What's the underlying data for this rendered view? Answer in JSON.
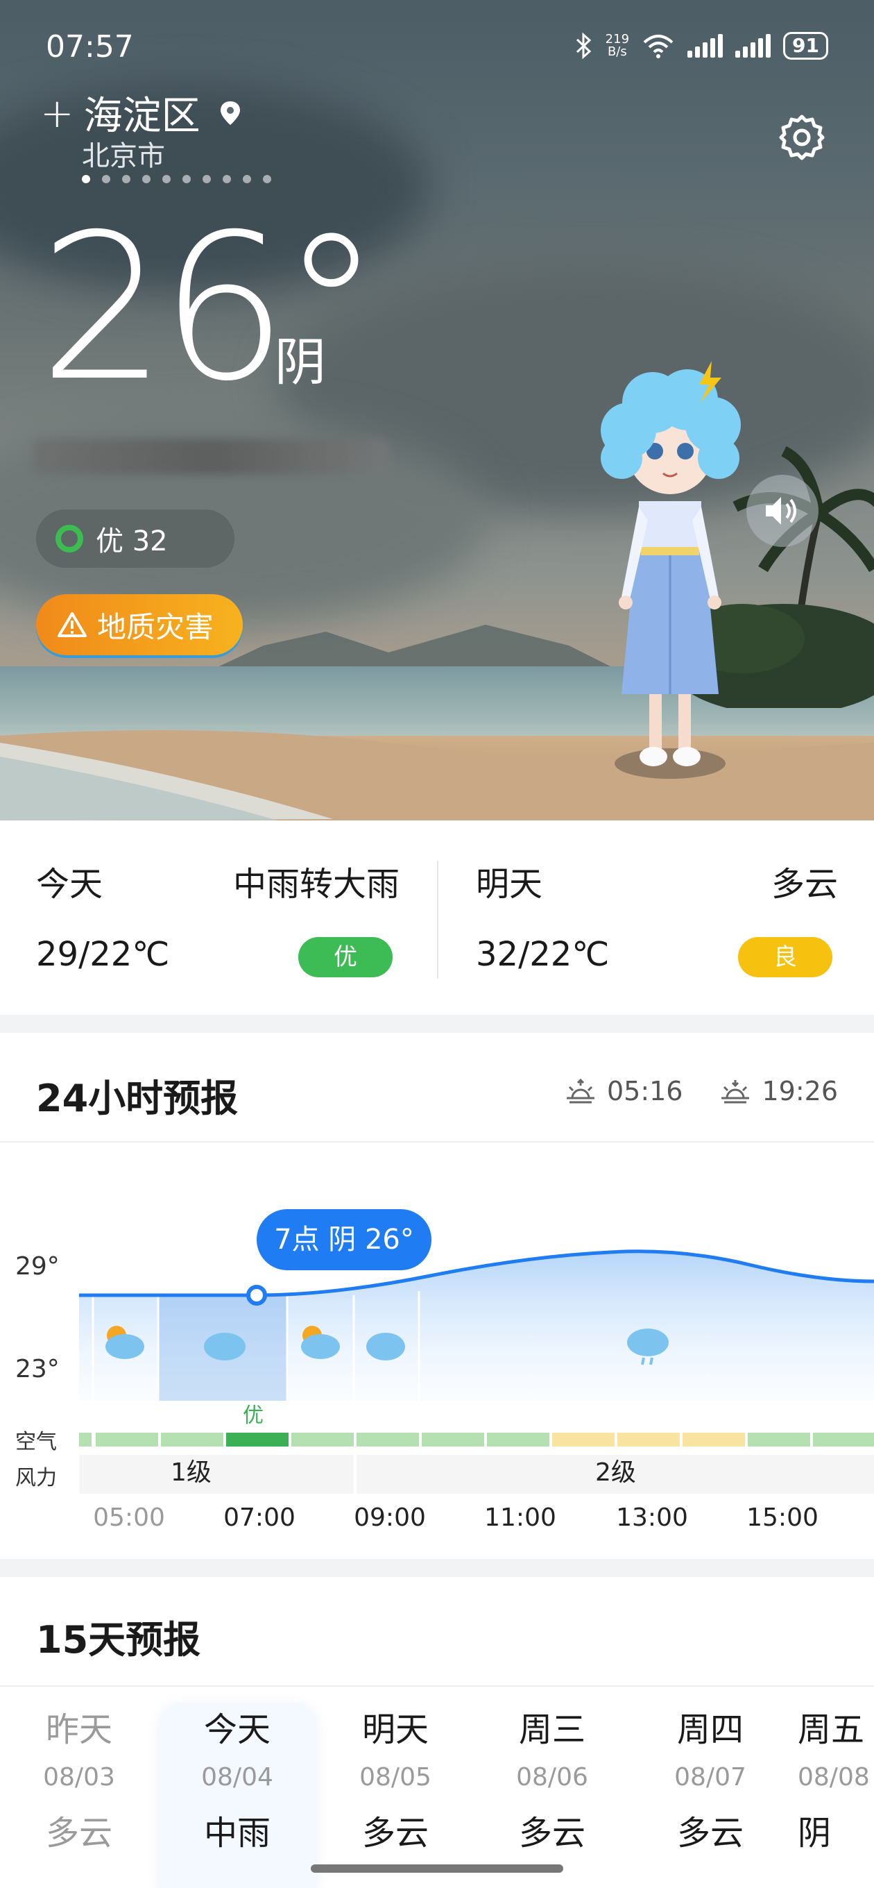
{
  "status": {
    "time": "07:57",
    "net_speed_top": "219",
    "net_speed_bottom": "B/s",
    "battery": "91"
  },
  "location": {
    "district": "海淀区",
    "city": "北京市"
  },
  "current": {
    "temperature": "26°",
    "condition": "阴",
    "aqi_text": "优 32",
    "alert_text": "地质灾害"
  },
  "today": {
    "label": "今天",
    "condition": "中雨转大雨",
    "range": "29/22℃",
    "aqi": "优",
    "aqi_color": "#3dbb54"
  },
  "tomorrow": {
    "label": "明天",
    "condition": "多云",
    "range": "32/22℃",
    "aqi": "良",
    "aqi_color": "#f6c20f"
  },
  "forecast24": {
    "title": "24小时预报",
    "sunrise": "05:16",
    "sunset": "19:26",
    "y_high_label": "29°",
    "y_low_label": "23°",
    "tooltip": "7点 阴 26°",
    "highlight_aqi": "优",
    "air_label": "空气",
    "wind_label": "风力",
    "wind_segments": [
      "1级",
      "2级"
    ],
    "times": [
      "05:00",
      "07:00",
      "09:00",
      "11:00",
      "13:00",
      "15:00"
    ],
    "accent_color": "#1f7cf2"
  },
  "forecast15": {
    "title": "15天预报",
    "days": [
      {
        "name": "昨天",
        "date": "08/03",
        "cond": "多云"
      },
      {
        "name": "今天",
        "date": "08/04",
        "cond": "中雨"
      },
      {
        "name": "明天",
        "date": "08/05",
        "cond": "多云"
      },
      {
        "name": "周三",
        "date": "08/06",
        "cond": "多云"
      },
      {
        "name": "周四",
        "date": "08/07",
        "cond": "多云"
      },
      {
        "name": "周五",
        "date": "08/08",
        "cond": "阴"
      }
    ]
  }
}
